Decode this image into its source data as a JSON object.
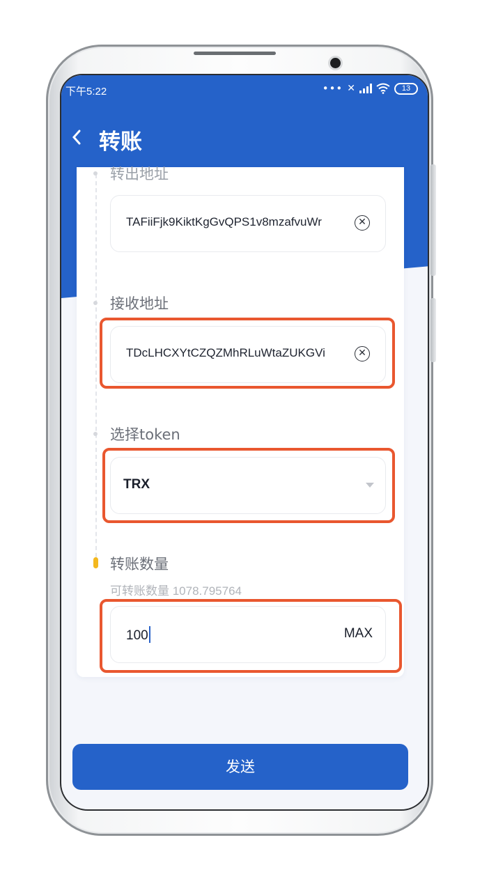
{
  "status_bar": {
    "time": "下午5:22",
    "battery": "13"
  },
  "nav": {
    "back_icon": "chevron-left-icon",
    "title": "转账"
  },
  "form": {
    "from": {
      "label": "转出地址",
      "value": "TAFiiFjk9KiktKgGvQPS1v8mzafvuWr",
      "clear_icon": "close-circle-icon"
    },
    "to": {
      "label": "接收地址",
      "value": "TDcLHCXYtCZQZMhRLuWtaZUKGVi",
      "clear_icon": "close-circle-icon"
    },
    "token": {
      "label": "选择token",
      "selected": "TRX",
      "dropdown_icon": "caret-down-icon"
    },
    "amount": {
      "label": "转账数量",
      "available": "可转账数量 1078.795764",
      "value": "100",
      "max_label": "MAX"
    }
  },
  "send_button": "发送",
  "colors": {
    "primary": "#2562c9",
    "highlight": "#e9572f",
    "active_step": "#f3b81f"
  }
}
